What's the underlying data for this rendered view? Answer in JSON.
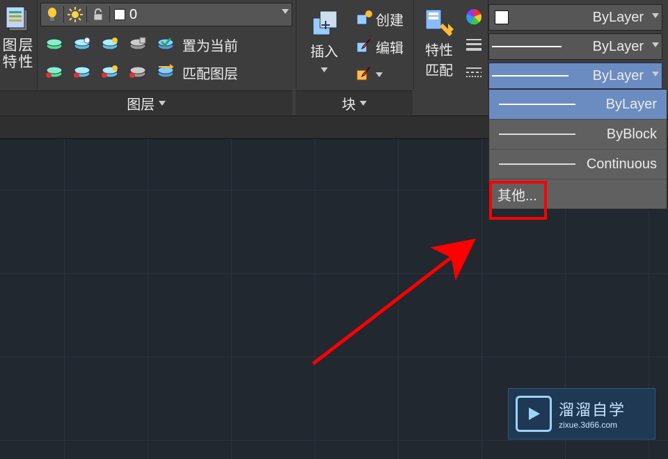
{
  "left_panel": {
    "line1": "图层",
    "line2": "特性"
  },
  "layer_row": {
    "current": "0"
  },
  "tools": {
    "set_current": "置为当前",
    "match_layer": "匹配图层"
  },
  "panel_tabs": {
    "layer": "图层",
    "blocks": "块"
  },
  "blocks": {
    "insert": "插入",
    "create": "创建",
    "edit": "编辑"
  },
  "props": {
    "match1": "特性",
    "match2": "匹配"
  },
  "bylayer": {
    "color": "ByLayer",
    "lineweight": "ByLayer",
    "linetype": "ByLayer"
  },
  "linetype_menu": {
    "bylayer": "ByLayer",
    "byblock": "ByBlock",
    "continuous": "Continuous",
    "other": "其他..."
  },
  "watermark": {
    "title": "溜溜自学",
    "sub": "zixue.3d66.com"
  }
}
